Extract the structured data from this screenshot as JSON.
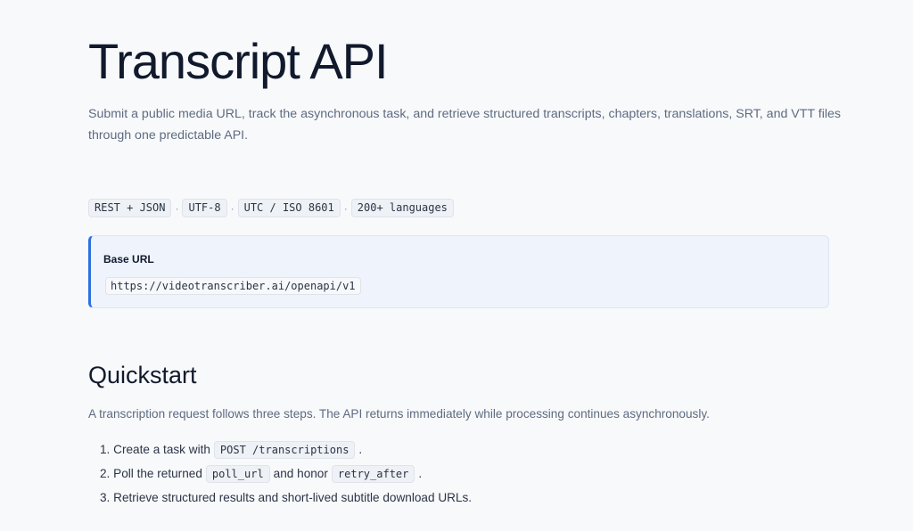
{
  "title": "Transcript API",
  "lead": "Submit a public media URL, track the asynchronous task, and retrieve structured transcripts, chapters, translations, SRT, and VTT files through one predictable API.",
  "tags": [
    "REST + JSON",
    "UTF-8",
    "UTC / ISO 8601",
    "200+ languages"
  ],
  "tag_separator": "·",
  "base_url": {
    "label": "Base URL",
    "value": "https://videotranscriber.ai/openapi/v1"
  },
  "quickstart": {
    "heading": "Quickstart",
    "intro": "A transcription request follows three steps. The API returns immediately while processing continues asynchronously.",
    "steps": [
      {
        "number": "1.",
        "before": "Create a task with",
        "code": "POST /transcriptions",
        "after": "."
      },
      {
        "number": "2.",
        "before": "Poll the returned",
        "code": "poll_url",
        "middle": "and honor",
        "code2": "retry_after",
        "after": "."
      },
      {
        "number": "3.",
        "text": "Retrieve structured results and short-lived subtitle download URLs."
      }
    ]
  },
  "colors": {
    "accent": "#2f6fe0",
    "background": "#f8f9fb",
    "callout_bg": "#eef3fc"
  }
}
